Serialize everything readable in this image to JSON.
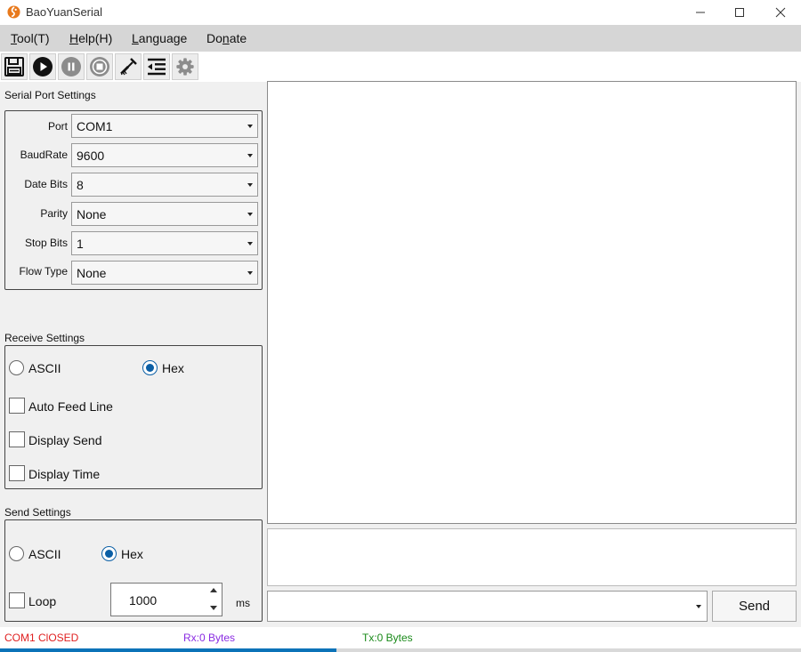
{
  "window": {
    "title": "BaoYuanSerial",
    "controls": {
      "minimize": "minimize-icon",
      "maximize": "maximize-icon",
      "close": "close-icon"
    }
  },
  "menu": {
    "items": [
      {
        "pre": "",
        "key": "T",
        "post": "ool(T)"
      },
      {
        "pre": "",
        "key": "H",
        "post": "elp(H)"
      },
      {
        "pre": "",
        "key": "L",
        "post": "anguage"
      },
      {
        "pre": "Do",
        "key": "n",
        "post": "ate"
      }
    ]
  },
  "toolbar": {
    "buttons": [
      "save-icon",
      "play-icon",
      "pause-icon",
      "stop-icon",
      "clear-icon",
      "indent-icon",
      "gear-icon"
    ]
  },
  "serial_settings": {
    "title": "Serial Port Settings",
    "fields": [
      {
        "label": "Port",
        "value": "COM1"
      },
      {
        "label": "BaudRate",
        "value": "9600"
      },
      {
        "label": "Date Bits",
        "value": "8"
      },
      {
        "label": "Parity",
        "value": "None"
      },
      {
        "label": "Stop Bits",
        "value": "1"
      },
      {
        "label": "Flow Type",
        "value": "None"
      }
    ]
  },
  "receive_settings": {
    "title": "Receive Settings",
    "ascii": {
      "label": "ASCII",
      "checked": false
    },
    "hex": {
      "label": "Hex",
      "checked": true
    },
    "auto_feed_line": {
      "label": "Auto Feed Line",
      "checked": false
    },
    "display_send": {
      "label": "Display Send",
      "checked": false
    },
    "display_time": {
      "label": "Display Time",
      "checked": false
    }
  },
  "send_settings": {
    "title": "Send Settings",
    "ascii": {
      "label": "ASCII",
      "checked": false
    },
    "hex": {
      "label": "Hex",
      "checked": true
    },
    "loop": {
      "label": "Loop",
      "checked": false
    },
    "interval": "1000",
    "interval_unit": "ms"
  },
  "send": {
    "button_label": "Send",
    "combo_value": ""
  },
  "status": {
    "port": "COM1 ClOSED",
    "rx": "Rx:0 Bytes",
    "tx": "Tx:0 Bytes",
    "progress": 0.42
  },
  "colors": {
    "accent": "#0b73b8",
    "status_port": "#e02020",
    "status_rx": "#8a2be2",
    "status_tx": "#1a8a1a"
  }
}
